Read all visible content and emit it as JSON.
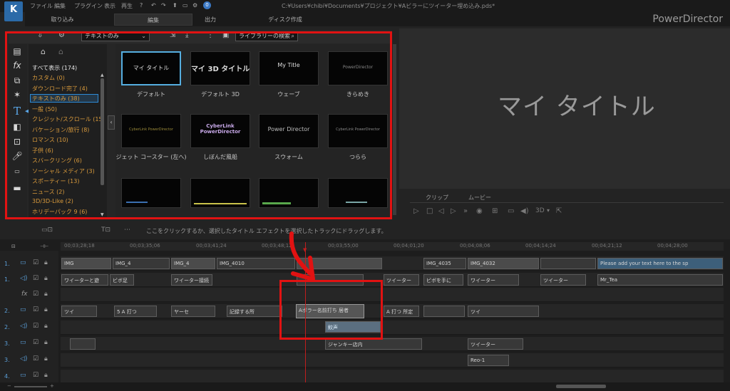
{
  "app": {
    "brand": "PowerDirector",
    "file_path": "C:¥Users¥chibi¥Documents¥プロジェクト¥Aビラーにツイーター埋め込み.pds*",
    "menu": [
      "ファイル",
      "編集",
      "プラグイン",
      "表示",
      "再生"
    ],
    "notification_count": "0"
  },
  "tabs": [
    "取り込み",
    "編集",
    "出力",
    "ディスク作成"
  ],
  "library": {
    "filter_value": "テキストのみ",
    "search_placeholder": "ライブラリーの検索",
    "categories": [
      "すべて表示 (174)",
      "カスタム (0)",
      "ダウンロード完了 (4)",
      "テキストのみ (38)",
      "一般 (50)",
      "クレジット/スクロール (15)",
      "バケーション/旅行 (8)",
      "ロマンス (10)",
      "子供 (6)",
      "スバークリング (6)",
      "ソーシャル メディア (3)",
      "スポーティー (13)",
      "ニュース (2)",
      "3D/3D-Like (2)",
      "ホリデーパック 9 (6)"
    ],
    "templates": [
      {
        "name": "デフォルト",
        "thumb": "マイ タイトル"
      },
      {
        "name": "デフォルト 3D",
        "thumb": "マイ 3D タイトル"
      },
      {
        "name": "ウェーブ",
        "thumb": "My Title"
      },
      {
        "name": "きらめき",
        "thumb": "PowerDirector"
      },
      {
        "name": "ジェット コースター (左へ)",
        "thumb": "CyberLink PowerDirector"
      },
      {
        "name": "しぼんだ風船",
        "thumb": "CyberLink PowerDirector"
      },
      {
        "name": "スウォーム",
        "thumb": "Power Director"
      },
      {
        "name": "つらら",
        "thumb": "CyberLink PowerDirector"
      }
    ]
  },
  "preview": {
    "title": "マイ タイトル",
    "tabs": [
      "クリップ",
      "ムービー"
    ],
    "mode": "3D"
  },
  "hint": "ここをクリックするか、選択したタイトル エフェクトを選択したトラックにドラッグします。",
  "timeline": {
    "ruler": [
      "00;03;28;18",
      "00;03;35;06",
      "00;03;41;24",
      "00;03;48;12",
      "00;03;55;00",
      "00;04;01;20",
      "00;04;08;06",
      "00;04;14;24",
      "00;04;21;12",
      "00;04;28;00"
    ],
    "row_labels": [
      "1.",
      "1.",
      "fx",
      "2.",
      "2.",
      "3.",
      "3.",
      "4."
    ],
    "clips_row1": [
      "IMG",
      "IMG_4",
      "IMG_4",
      "IMG_4010",
      "IMG_4035",
      "IMG_4032",
      "Please add your text here to the sp"
    ],
    "clips_row2": [
      "ワイーターと遊",
      "ビボ足",
      "ワイーター接続",
      "ツイーター",
      "ビボを手に",
      "ワイーター",
      "ツイーター"
    ],
    "clips_row4": [
      "ツイ",
      "5 A 打つ",
      "ヤーセ",
      "記録する所",
      "A 打つ 所定",
      "ツイ"
    ],
    "title_clip": "Aボラー名前打ち 居者",
    "audio_clip": "鮫声",
    "clips_row6": [
      "ジャンキー店内",
      "ツイーター"
    ],
    "clip_mr_tea": "Mr_Tea",
    "clip_reo": "Reo-1"
  }
}
